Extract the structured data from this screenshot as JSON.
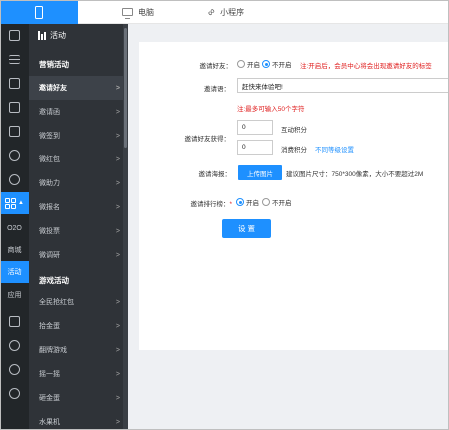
{
  "topbar": {
    "phone_icon": "phone-icon",
    "tabs": [
      {
        "label": "电脑",
        "icon": "monitor-icon"
      },
      {
        "label": "小程序",
        "icon": "link-icon"
      }
    ]
  },
  "rail": {
    "icons": [
      "dashboard-icon",
      "list-icon",
      "chat-icon",
      "document-icon",
      "image-icon",
      "user-icon",
      "refresh-icon",
      "grid-icon"
    ],
    "text_items": [
      "O2O",
      "商城",
      "活动",
      "应用"
    ],
    "active_text": "活动",
    "bottom_icons": [
      "notepad-icon",
      "message-icon",
      "compass-icon",
      "settings-icon"
    ]
  },
  "submenu": {
    "header": "活动",
    "sections": [
      {
        "title": "营销活动",
        "items": [
          "邀请好友",
          "邀请函",
          "微签到",
          "微红包",
          "微助力",
          "微报名",
          "微投票",
          "微调研"
        ]
      },
      {
        "title": "游戏活动",
        "items": [
          "全民抢红包",
          "拾金蛋",
          "翻牌游戏",
          "摇一摇",
          "砸金蛋",
          "水果机"
        ]
      }
    ],
    "active_item": "邀请好友",
    "arrow": ">"
  },
  "form": {
    "invite_friends": {
      "label": "邀请好友：",
      "option_on": "开启",
      "option_off": "不开启",
      "selected": "不开启",
      "note": "注:开启后，会员中心将会出现邀请好友的标签"
    },
    "invite_text": {
      "label": "邀请语：",
      "value": "赶快来体验吧!",
      "hint": "注:最多可输入50个字符"
    },
    "reward": {
      "label": "邀请好友获得：",
      "points_value": "0",
      "points_label": "互动积分",
      "spend_value": "0",
      "spend_label": "消费积分",
      "level_link": "不同等级设置"
    },
    "poster": {
      "label": "邀请海报：",
      "upload_button": "上传图片",
      "hint": "建议图片尺寸：750*300像素，大小不要超过2M"
    },
    "ranking": {
      "label": "邀请排行榜：",
      "required_mark": "*",
      "option_on": "开启",
      "option_off": "不开启",
      "selected": "开启"
    },
    "save_button": "设 置"
  },
  "colors": {
    "accent": "#1e90ff",
    "rail_bg": "#222629",
    "submenu_bg": "#2f3338",
    "warning": "#e02020"
  }
}
